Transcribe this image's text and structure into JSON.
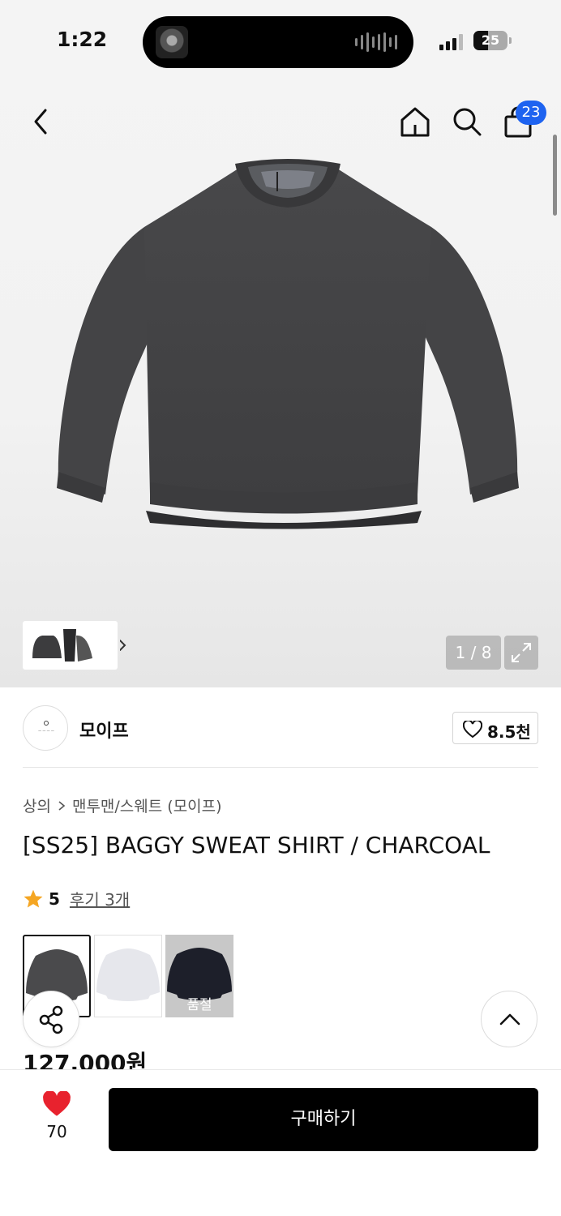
{
  "status_bar": {
    "time": "1:22",
    "battery": "25"
  },
  "header": {
    "cart_count": "23",
    "icons": [
      "back-icon",
      "home-icon",
      "search-icon",
      "shopping-bag-icon"
    ]
  },
  "gallery": {
    "counter": "1 / 8"
  },
  "brand": {
    "name": "모이프",
    "like_count": "8.5천"
  },
  "breadcrumb": {
    "category": "상의",
    "subcategory": "맨투맨/스웨트 (모이프)"
  },
  "product": {
    "title": "[SS25] BAGGY SWEAT SHIRT / CHARCOAL",
    "rating": "5",
    "reviews": "후기 3개",
    "price": "127,000원"
  },
  "swatches": [
    {
      "color": "#4a4a4c",
      "soldout": ""
    },
    {
      "color": "#e6e7ec",
      "soldout": ""
    },
    {
      "color": "#1d1f2a",
      "soldout": "품절"
    }
  ],
  "bottom_bar": {
    "wish_count": "70",
    "buy_label": "구매하기"
  },
  "colors": {
    "accent_blue": "#1e63f0",
    "heart_red": "#e8222e",
    "star_orange": "#f5a623"
  }
}
